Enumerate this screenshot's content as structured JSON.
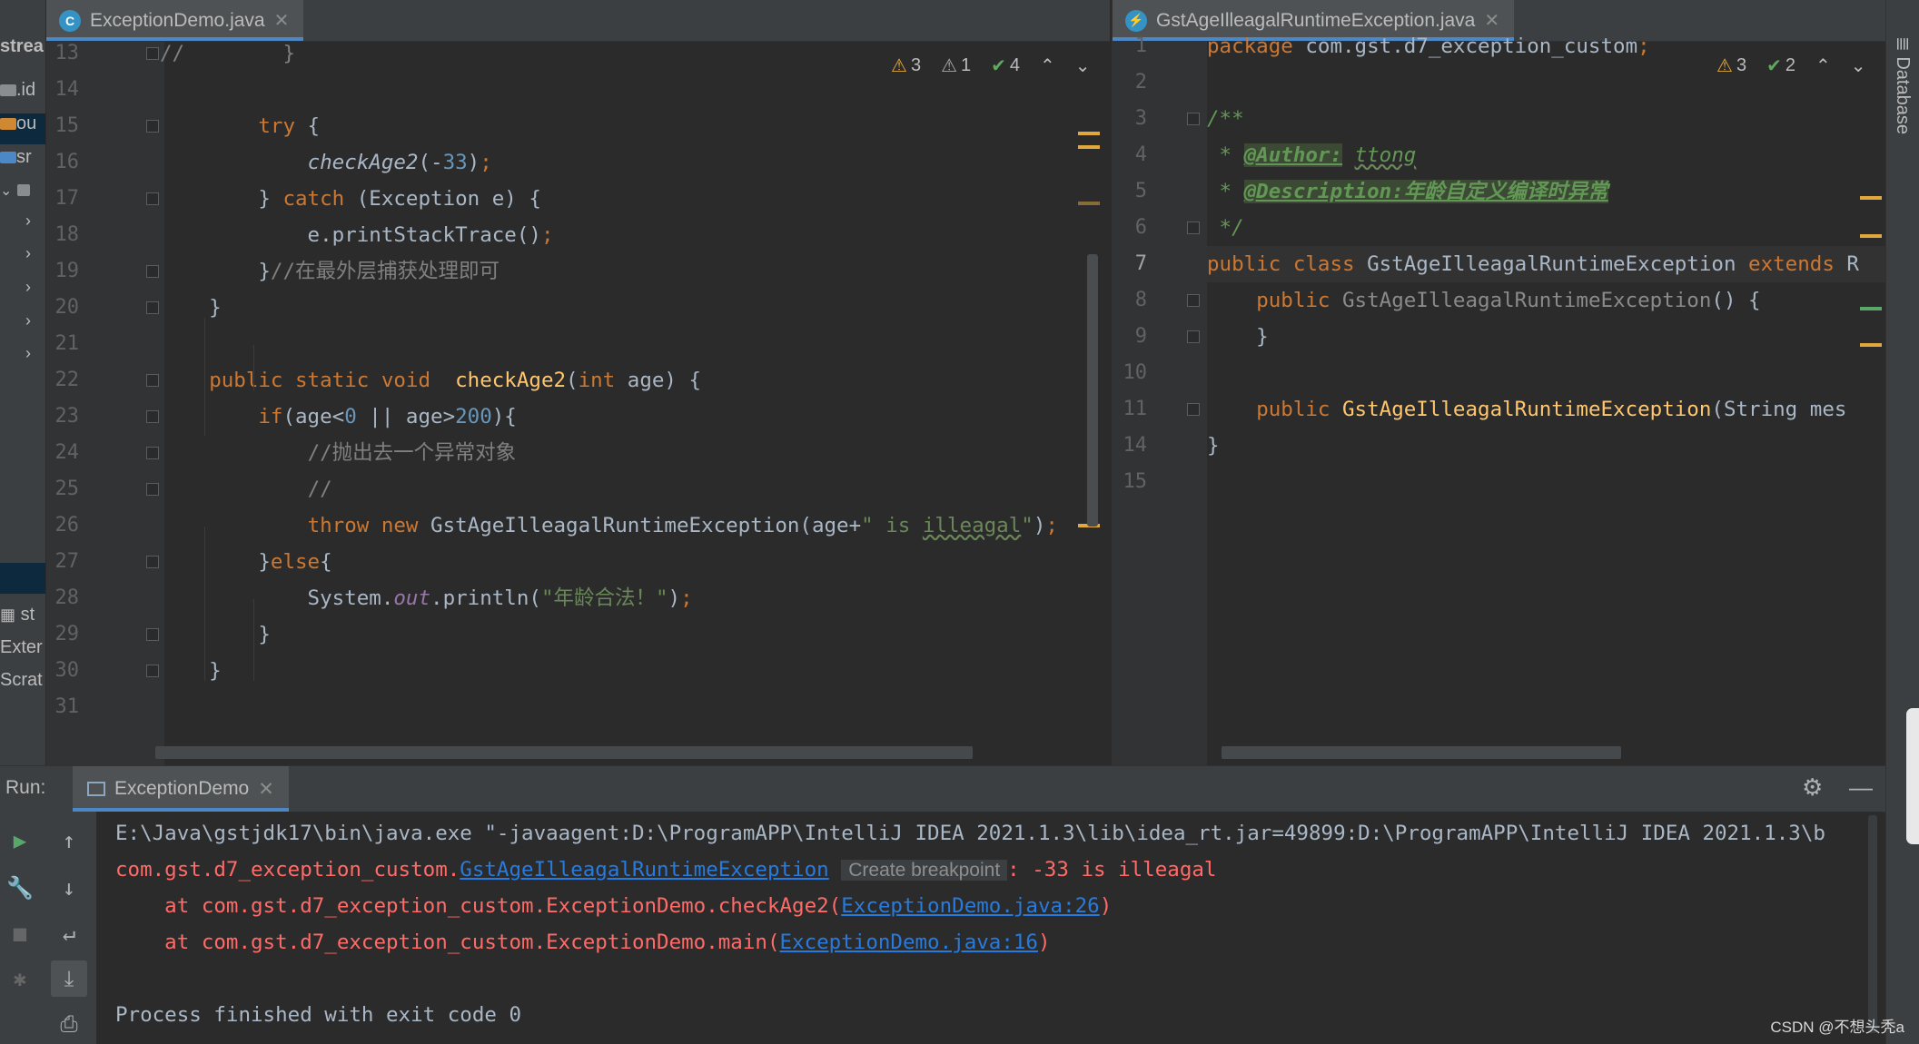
{
  "project_panel": {
    "rows": [
      {
        "label": "strea",
        "kind": "title"
      },
      {
        "label": ".id",
        "kind": "folder-gray"
      },
      {
        "label": "ou",
        "kind": "folder-orange"
      },
      {
        "label": "sr",
        "kind": "folder-blue"
      },
      {
        "label": "",
        "kind": "module"
      },
      {
        "label": "",
        "kind": "chevron"
      },
      {
        "label": "",
        "kind": "chevron"
      },
      {
        "label": "",
        "kind": "chevron"
      },
      {
        "label": "",
        "kind": "chevron"
      },
      {
        "label": "",
        "kind": "chevron"
      },
      {
        "label": "st",
        "kind": "lib"
      },
      {
        "label": "Exter",
        "kind": "text"
      },
      {
        "label": "Scrat",
        "kind": "text"
      }
    ]
  },
  "left_editor": {
    "tab": {
      "label": "ExceptionDemo.java",
      "icon_letter": "C"
    },
    "inspections": {
      "warnings": "3",
      "weak_warnings": "1",
      "ok": "4"
    },
    "lines": [
      {
        "no": "13",
        "parts": [
          {
            "t": "//        }",
            "c": "cmt"
          }
        ]
      },
      {
        "no": "14",
        "parts": []
      },
      {
        "no": "15",
        "parts": [
          {
            "t": "        "
          },
          {
            "t": "try",
            "c": "kw"
          },
          {
            "t": " {"
          }
        ]
      },
      {
        "no": "16",
        "parts": [
          {
            "t": "            "
          },
          {
            "t": "checkAge2",
            "c": "ital"
          },
          {
            "t": "(-"
          },
          {
            "t": "33",
            "c": "num"
          },
          {
            "t": ")"
          },
          {
            "t": ";",
            "c": "kw"
          }
        ]
      },
      {
        "no": "17",
        "parts": [
          {
            "t": "        } "
          },
          {
            "t": "catch",
            "c": "kw"
          },
          {
            "t": " (Exception e) {"
          }
        ]
      },
      {
        "no": "18",
        "parts": [
          {
            "t": "            e.printStackTrace()"
          },
          {
            "t": ";",
            "c": "kw"
          }
        ]
      },
      {
        "no": "19",
        "parts": [
          {
            "t": "        }"
          },
          {
            "t": "//在最外层捕获处理即可",
            "c": "cmt"
          }
        ]
      },
      {
        "no": "20",
        "parts": [
          {
            "t": "    }"
          }
        ]
      },
      {
        "no": "21",
        "parts": []
      },
      {
        "no": "22",
        "parts": [
          {
            "t": "    "
          },
          {
            "t": "public static void",
            "c": "kw"
          },
          {
            "t": "  "
          },
          {
            "t": "checkAge2",
            "c": "fn"
          },
          {
            "t": "("
          },
          {
            "t": "int",
            "c": "kw"
          },
          {
            "t": " age) {"
          }
        ]
      },
      {
        "no": "23",
        "parts": [
          {
            "t": "        "
          },
          {
            "t": "if",
            "c": "kw"
          },
          {
            "t": "(age<"
          },
          {
            "t": "0",
            "c": "num"
          },
          {
            "t": " || age>"
          },
          {
            "t": "200",
            "c": "num"
          },
          {
            "t": "){"
          }
        ]
      },
      {
        "no": "24",
        "parts": [
          {
            "t": "            "
          },
          {
            "t": "//抛出去一个异常对象",
            "c": "cmt"
          }
        ]
      },
      {
        "no": "25",
        "parts": [
          {
            "t": "            "
          },
          {
            "t": "//",
            "c": "cmt"
          }
        ]
      },
      {
        "no": "26",
        "parts": [
          {
            "t": "            "
          },
          {
            "t": "throw new",
            "c": "kw"
          },
          {
            "t": " GstAgeIlleagalRuntimeException(age+"
          },
          {
            "t": "\" is ",
            "c": "str"
          },
          {
            "t": "illeagal",
            "c": "str squig"
          },
          {
            "t": "\"",
            "c": "str"
          },
          {
            "t": ")"
          },
          {
            "t": ";",
            "c": "kw"
          }
        ]
      },
      {
        "no": "27",
        "parts": [
          {
            "t": "        }"
          },
          {
            "t": "else",
            "c": "kw"
          },
          {
            "t": "{"
          }
        ]
      },
      {
        "no": "28",
        "parts": [
          {
            "t": "            System."
          },
          {
            "t": "out",
            "c": "field"
          },
          {
            "t": ".println("
          },
          {
            "t": "\"年龄合法！\"",
            "c": "str"
          },
          {
            "t": ")"
          },
          {
            "t": ";",
            "c": "kw"
          }
        ]
      },
      {
        "no": "29",
        "parts": [
          {
            "t": "        }"
          }
        ]
      },
      {
        "no": "30",
        "parts": [
          {
            "t": "    }"
          }
        ]
      },
      {
        "no": "31",
        "parts": []
      }
    ]
  },
  "right_editor": {
    "tab": {
      "label": "GstAgeIlleagalRuntimeException.java",
      "icon_letter": "⚡"
    },
    "inspections": {
      "warnings": "3",
      "ok": "2"
    },
    "lines": [
      {
        "no": "1",
        "parts": [
          {
            "t": "package",
            "c": "kw"
          },
          {
            "t": " com.gst.d7_exception_custom"
          },
          {
            "t": ";",
            "c": "kw"
          }
        ]
      },
      {
        "no": "2",
        "parts": []
      },
      {
        "no": "3",
        "parts": [
          {
            "t": "/**",
            "c": "doc"
          }
        ]
      },
      {
        "no": "4",
        "parts": [
          {
            "t": " * ",
            "c": "doc"
          },
          {
            "t": "@Author:",
            "c": "doctag"
          },
          {
            "t": " ",
            "c": "doc"
          },
          {
            "t": "ttong",
            "c": "doc squig"
          }
        ]
      },
      {
        "no": "5",
        "parts": [
          {
            "t": " * ",
            "c": "doc"
          },
          {
            "t": "@Description:年龄自定义编译时异常",
            "c": "doctag"
          }
        ]
      },
      {
        "no": "6",
        "parts": [
          {
            "t": " */",
            "c": "doc"
          }
        ]
      },
      {
        "no": "7",
        "parts": [
          {
            "t": "public class",
            "c": "kw"
          },
          {
            "t": " GstAgeIlleagalRuntimeException "
          },
          {
            "t": "extends",
            "c": "kw"
          },
          {
            "t": " R"
          }
        ]
      },
      {
        "no": "8",
        "parts": [
          {
            "t": "    "
          },
          {
            "t": "public",
            "c": "kw"
          },
          {
            "t": " "
          },
          {
            "t": "GstAgeIlleagalRuntimeException",
            "c": "ctor"
          },
          {
            "t": "() {"
          }
        ]
      },
      {
        "no": "9",
        "parts": [
          {
            "t": "    }"
          }
        ]
      },
      {
        "no": "10",
        "parts": []
      },
      {
        "no": "11",
        "parts": [
          {
            "t": "    "
          },
          {
            "t": "public",
            "c": "kw"
          },
          {
            "t": " "
          },
          {
            "t": "GstAgeIlleagalRuntimeException",
            "c": "fn"
          },
          {
            "t": "(String mes"
          }
        ]
      },
      {
        "no": "14",
        "parts": [
          {
            "t": "}"
          }
        ]
      },
      {
        "no": "15",
        "parts": []
      }
    ]
  },
  "right_toolwindow": {
    "label": "Database"
  },
  "run_panel": {
    "label": "Run:",
    "tab_label": "ExceptionDemo",
    "console": {
      "line1": "E:\\Java\\gstjdk17\\bin\\java.exe \"-javaagent:D:\\ProgramAPP\\IntelliJ IDEA 2021.1.3\\lib\\idea_rt.jar=49899:D:\\ProgramAPP\\IntelliJ IDEA 2021.1.3\\b",
      "exc_prefix": "com.gst.d7_exception_custom.",
      "exc_class": "GstAgeIlleagalRuntimeException",
      "tooltip": "Create breakpoint",
      "exc_msg": ": -33 is illeagal",
      "at1_prefix": "    at com.gst.d7_exception_custom.ExceptionDemo.checkAge2(",
      "at1_link": "ExceptionDemo.java:26",
      "at2_prefix": "    at com.gst.d7_exception_custom.ExceptionDemo.main(",
      "at2_link": "ExceptionDemo.java:16",
      "close_paren": ")",
      "exit": "Process finished with exit code 0"
    }
  },
  "watermark": "CSDN @不想头秃a"
}
